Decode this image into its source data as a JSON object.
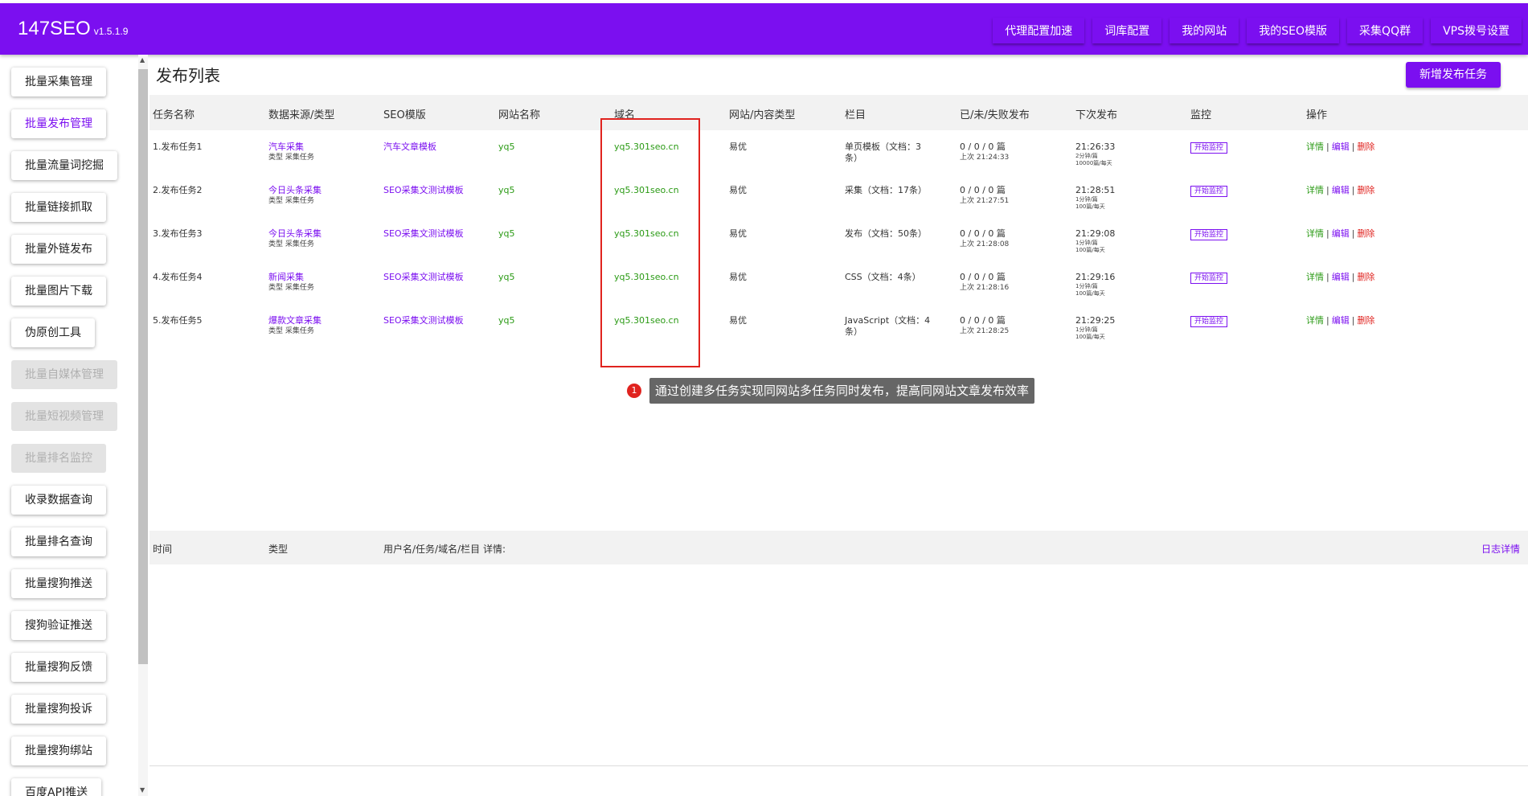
{
  "header": {
    "brand": "147SEO",
    "version": "v1.5.1.9",
    "nav": [
      "代理配置加速",
      "词库配置",
      "我的网站",
      "我的SEO模版",
      "采集QQ群",
      "VPS拨号设置"
    ],
    "accent": "#7b0ff0"
  },
  "sidebar": {
    "items": [
      {
        "label": "批量采集管理"
      },
      {
        "label": "批量发布管理"
      },
      {
        "label": "批量流量词挖掘"
      },
      {
        "label": "批量链接抓取"
      },
      {
        "label": "批量外链发布"
      },
      {
        "label": "批量图片下载"
      },
      {
        "label": "伪原创工具"
      },
      {
        "label": "批量自媒体管理"
      },
      {
        "label": "批量短视频管理"
      },
      {
        "label": "批量排名监控"
      },
      {
        "label": "收录数据查询"
      },
      {
        "label": "批量排名查询"
      },
      {
        "label": "批量搜狗推送"
      },
      {
        "label": "搜狗验证推送"
      },
      {
        "label": "批量搜狗反馈"
      },
      {
        "label": "批量搜狗投诉"
      },
      {
        "label": "批量搜狗绑站"
      },
      {
        "label": "百度API推送"
      }
    ],
    "active_index": 1,
    "disabled_indices": [
      7,
      8,
      9
    ]
  },
  "main": {
    "title": "发布列表",
    "add_button": "新增发布任务",
    "columns": [
      "任务名称",
      "数据来源/类型",
      "SEO模版",
      "网站名称",
      "域名",
      "网站/内容类型",
      "栏目",
      "已/未/失败发布",
      "下次发布",
      "监控",
      "操作"
    ],
    "rows": [
      {
        "name": "1.发布任务1",
        "source": "汽车采集",
        "source_type": "类型  采集任务",
        "template": "汽车文章模板",
        "site": "yq5",
        "domain": "yq5.301seo.cn",
        "site_type": "易优",
        "column_line1": "单页模板（文档：3",
        "column_line2": "条）",
        "counts": "0 / 0 / 0 篇",
        "last": "上次 21:24:33",
        "next_time": "21:26:33",
        "next_interval": "2分钟/篇",
        "next_limit": "10000篇/每天",
        "monitor": "开始监控",
        "action_detail": "详情",
        "action_edit": "编辑",
        "action_delete": "删除"
      },
      {
        "name": "2.发布任务2",
        "source": "今日头条采集",
        "source_type": "类型  采集任务",
        "template": "SEO采集文测试模板",
        "site": "yq5",
        "domain": "yq5.301seo.cn",
        "site_type": "易优",
        "column_line1": "采集（文档：17条）",
        "column_line2": "",
        "counts": "0 / 0 / 0 篇",
        "last": "上次 21:27:51",
        "next_time": "21:28:51",
        "next_interval": "1分钟/篇",
        "next_limit": "100篇/每天",
        "monitor": "开始监控",
        "action_detail": "详情",
        "action_edit": "编辑",
        "action_delete": "删除"
      },
      {
        "name": "3.发布任务3",
        "source": "今日头条采集",
        "source_type": "类型  采集任务",
        "template": "SEO采集文测试模板",
        "site": "yq5",
        "domain": "yq5.301seo.cn",
        "site_type": "易优",
        "column_line1": "发布（文档：50条）",
        "column_line2": "",
        "counts": "0 / 0 / 0 篇",
        "last": "上次 21:28:08",
        "next_time": "21:29:08",
        "next_interval": "1分钟/篇",
        "next_limit": "100篇/每天",
        "monitor": "开始监控",
        "action_detail": "详情",
        "action_edit": "编辑",
        "action_delete": "删除"
      },
      {
        "name": "4.发布任务4",
        "source": "新闻采集",
        "source_type": "类型  采集任务",
        "template": "SEO采集文测试模板",
        "site": "yq5",
        "domain": "yq5.301seo.cn",
        "site_type": "易优",
        "column_line1": "CSS（文档：4条）",
        "column_line2": "",
        "counts": "0 / 0 / 0 篇",
        "last": "上次 21:28:16",
        "next_time": "21:29:16",
        "next_interval": "1分钟/篇",
        "next_limit": "100篇/每天",
        "monitor": "开始监控",
        "action_detail": "详情",
        "action_edit": "编辑",
        "action_delete": "删除"
      },
      {
        "name": "5.发布任务5",
        "source": "爆款文章采集",
        "source_type": "类型  采集任务",
        "template": "SEO采集文测试模板",
        "site": "yq5",
        "domain": "yq5.301seo.cn",
        "site_type": "易优",
        "column_line1": "JavaScript（文档：4",
        "column_line2": "条）",
        "counts": "0 / 0 / 0 篇",
        "last": "上次 21:28:25",
        "next_time": "21:29:25",
        "next_interval": "1分钟/篇",
        "next_limit": "100篇/每天",
        "monitor": "开始监控",
        "action_detail": "详情",
        "action_edit": "编辑",
        "action_delete": "删除"
      }
    ],
    "tooltip_number": "1",
    "tooltip_text": "通过创建多任务实现同网站多任务同时发布，提高同网站文章发布效率"
  },
  "log": {
    "columns": [
      "时间",
      "类型",
      "用户名/任务/域名/栏目 详情:"
    ],
    "detail_link": "日志详情"
  }
}
